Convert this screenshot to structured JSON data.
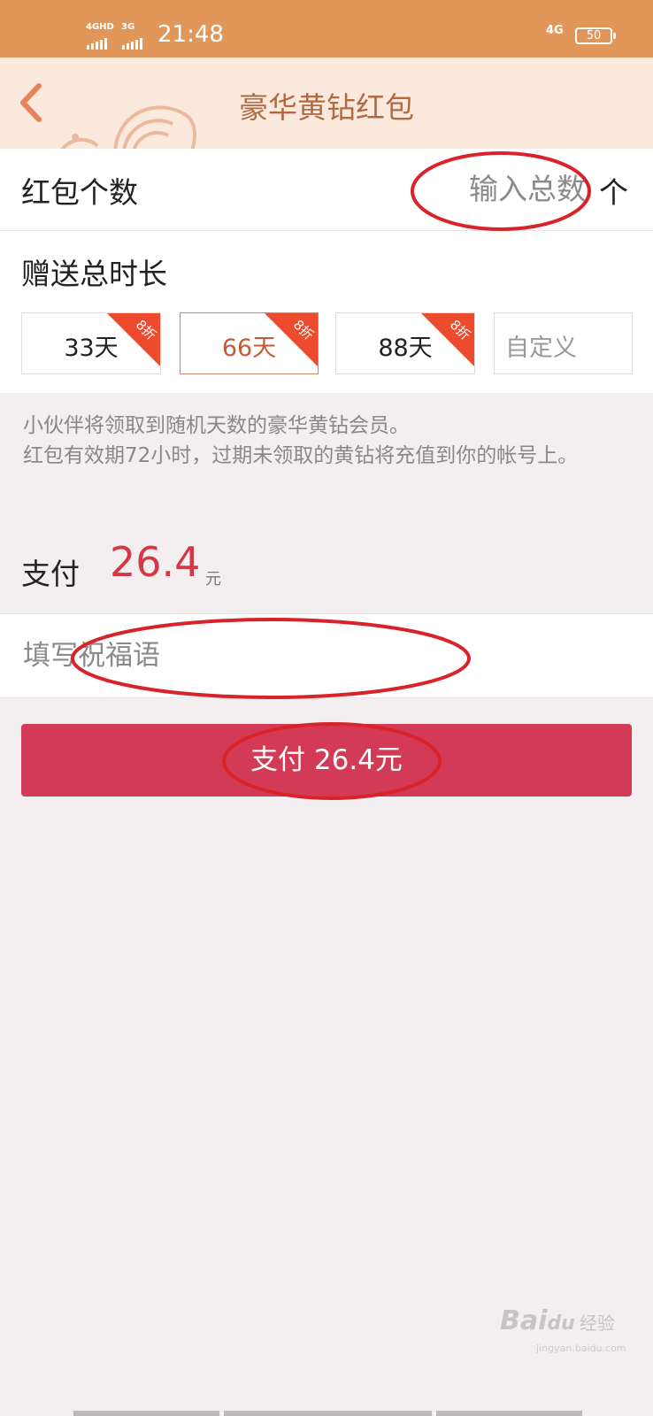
{
  "status_bar": {
    "network_1": "4GHD",
    "network_2": "3G",
    "time": "21:48",
    "network_right": "4G",
    "battery": "50"
  },
  "nav": {
    "back_icon": "chevron-left-icon",
    "title": "豪华黄钻红包"
  },
  "count": {
    "label": "红包个数",
    "placeholder": "输入总数",
    "value": "",
    "unit": "个"
  },
  "duration": {
    "title": "赠送总时长",
    "options": [
      {
        "label": "33天",
        "badge": "8折",
        "selected": false
      },
      {
        "label": "66天",
        "badge": "8折",
        "selected": true
      },
      {
        "label": "88天",
        "badge": "8折",
        "selected": false
      },
      {
        "label": "自定义",
        "badge": "",
        "selected": false
      }
    ]
  },
  "notice": {
    "line1": "小伙伴将领取到随机天数的豪华黄钻会员。",
    "line2": "红包有效期72小时，过期未领取的黄钻将充值到你的帐号上。"
  },
  "payment": {
    "label": "支付",
    "amount": "26.4",
    "unit": "元"
  },
  "wish": {
    "placeholder": "填写祝福语",
    "value": ""
  },
  "pay_button": {
    "label": "支付 26.4元"
  },
  "watermark": {
    "brand": "Bai",
    "brand_2": "du",
    "suffix": "经验",
    "url": "jingyan.baidu.com"
  },
  "colors": {
    "status_bar": "#e2975a",
    "nav_bg": "#fce9dd",
    "accent_red": "#d23a55",
    "price_red": "#d53744",
    "badge_red": "#ec4b2e",
    "annotation": "#d9232a"
  }
}
